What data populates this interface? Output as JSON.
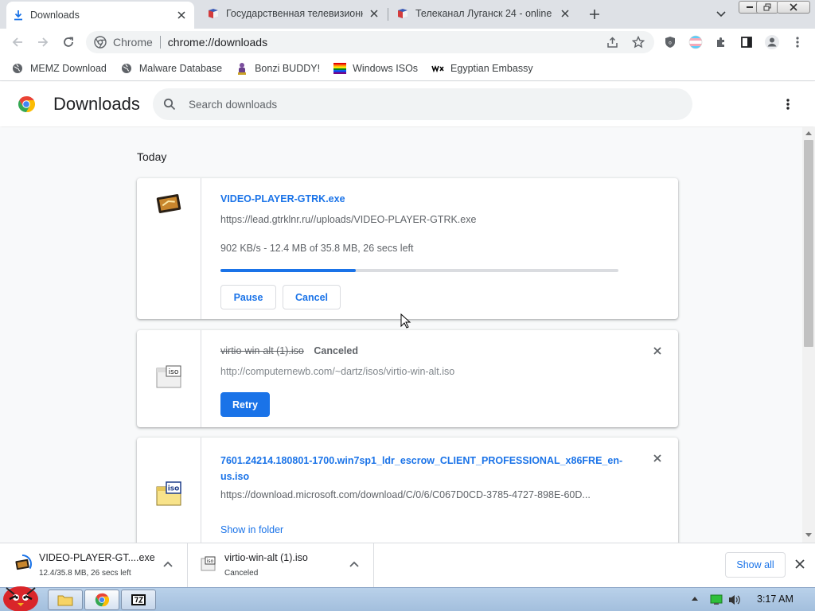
{
  "tabs": [
    {
      "title": "Downloads",
      "active": true,
      "icon": "download-icon"
    },
    {
      "title": "Государственная телевизионна",
      "active": false,
      "icon": "gtrk-favicon"
    },
    {
      "title": "Телеканал Луганск 24 - online",
      "active": false,
      "icon": "lugansk-favicon"
    }
  ],
  "omnibox": {
    "scheme_label": "Chrome",
    "url": "chrome://downloads"
  },
  "bookmarks": [
    {
      "label": "MEMZ Download",
      "icon": "globe-icon"
    },
    {
      "label": "Malware Database",
      "icon": "globe-icon"
    },
    {
      "label": "Bonzi BUDDY!",
      "icon": "bonzi-icon"
    },
    {
      "label": "Windows ISOs",
      "icon": "rainbow-flag-icon"
    },
    {
      "label": "Egyptian Embassy",
      "icon": "wix-icon"
    }
  ],
  "page": {
    "title": "Downloads",
    "search_placeholder": "Search downloads"
  },
  "section_label": "Today",
  "downloads": [
    {
      "filename": "VIDEO-PLAYER-GTRK.exe",
      "url": "https://lead.gtrklnr.ru//uploads/VIDEO-PLAYER-GTRK.exe",
      "status": "902 KB/s - 12.4 MB of 35.8 MB, 26 secs left",
      "progress": 0.34,
      "buttons": [
        "Pause",
        "Cancel"
      ]
    },
    {
      "filename": "virtio-win-alt (1).iso",
      "state": "Canceled",
      "url": "http://computernewb.com/~dartz/isos/virtio-win-alt.iso",
      "button": "Retry"
    },
    {
      "filename_line1": "7601.24214.180801-1700.win7sp1_ldr_escrow_CLIENT_PROFESSIONAL_x86FRE_en-",
      "filename_line2": "us.iso",
      "url": "https://download.microsoft.com/download/C/0/6/C067D0CD-3785-4727-898E-60D...",
      "link": "Show in folder"
    }
  ],
  "shelf": {
    "items": [
      {
        "name": "VIDEO-PLAYER-GT....exe",
        "status": "12.4/35.8 MB, 26 secs left"
      },
      {
        "name": "virtio-win-alt (1).iso",
        "status": "Canceled"
      }
    ],
    "show_all": "Show all"
  },
  "taskbar": {
    "clock": "3:17 AM"
  },
  "colors": {
    "accent": "#1a73e8",
    "tabstrip": "#dee1e6",
    "taskbar": "#b9d1ea"
  }
}
